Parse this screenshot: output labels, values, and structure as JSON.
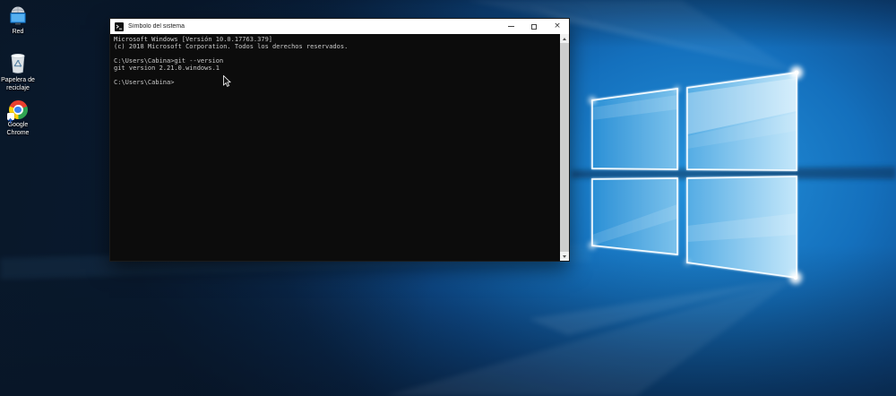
{
  "wallpaper": {
    "base_color": "#081c36",
    "glow_color": "#2492dc",
    "logo": "windows-10-hero"
  },
  "desktop_icons": [
    {
      "id": "network",
      "label": "Red"
    },
    {
      "id": "recycle-bin",
      "label": "Papelera de reciclaje"
    },
    {
      "id": "chrome",
      "label": "Google Chrome"
    }
  ],
  "window": {
    "title": "Símbolo del sistema",
    "controls": {
      "close_glyph": "×"
    },
    "console": {
      "lines": [
        "Microsoft Windows [Versión 10.0.17763.379]",
        "(c) 2018 Microsoft Corporation. Todos los derechos reservados.",
        "",
        "C:\\Users\\Cabina>git --version",
        "git version 2.21.0.windows.1",
        "",
        "C:\\Users\\Cabina>"
      ]
    }
  }
}
